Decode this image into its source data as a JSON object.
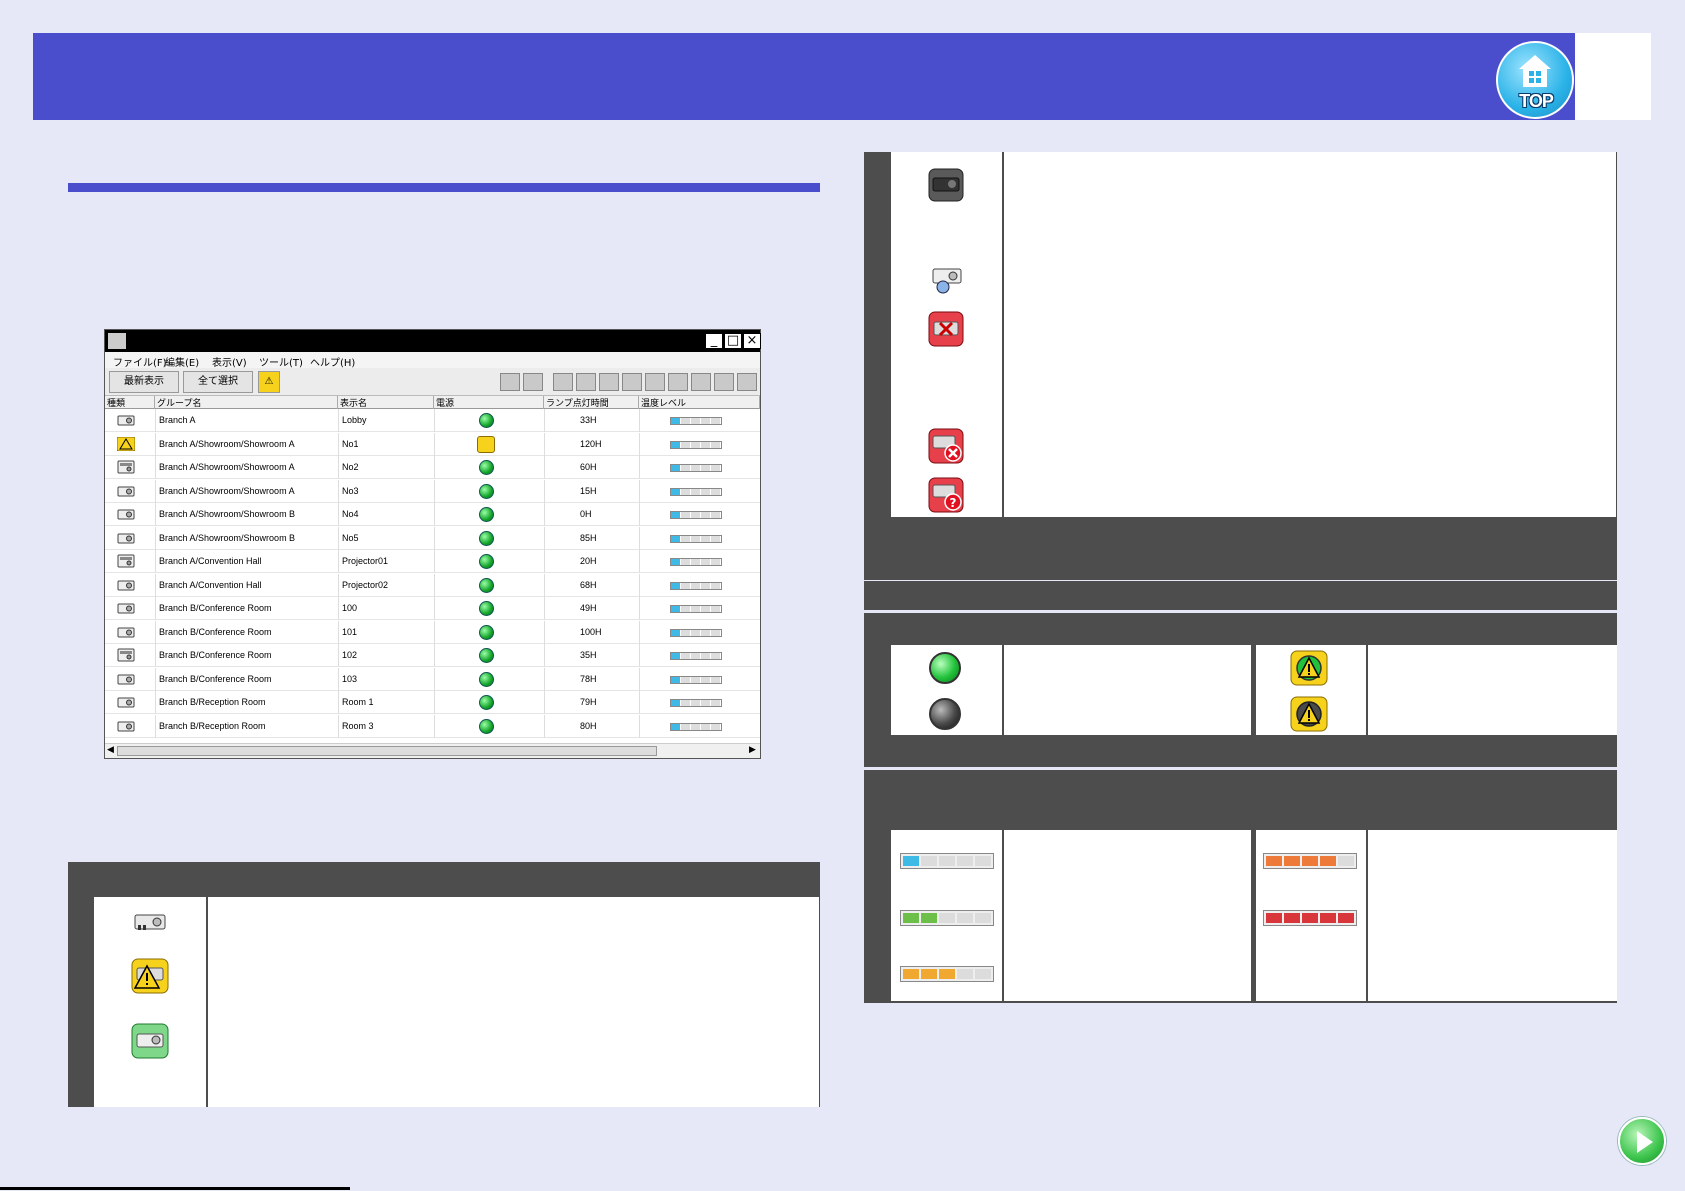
{
  "header": {
    "top_button_label": "TOP"
  },
  "window": {
    "menu": [
      "ファイル(F)",
      "編集(E)",
      "表示(V)",
      "ツール(T)",
      "ヘルプ(H)"
    ],
    "toolbar": {
      "refresh_label": "最新表示",
      "select_all_label": "全て選択"
    },
    "columns": [
      "種類",
      "グループ名",
      "表示名",
      "電源",
      "ランプ点灯時間",
      "温度レベル"
    ],
    "rows": [
      {
        "group": "Branch A",
        "name": "Lobby",
        "hours": "33H",
        "status": "normal"
      },
      {
        "group": "Branch A/Showroom/Showroom A",
        "name": "No1",
        "hours": "120H",
        "status": "warning"
      },
      {
        "group": "Branch A/Showroom/Showroom A",
        "name": "No2",
        "hours": "60H",
        "status": "multi"
      },
      {
        "group": "Branch A/Showroom/Showroom A",
        "name": "No3",
        "hours": "15H",
        "status": "normal"
      },
      {
        "group": "Branch A/Showroom/Showroom B",
        "name": "No4",
        "hours": "0H",
        "status": "normal"
      },
      {
        "group": "Branch A/Showroom/Showroom B",
        "name": "No5",
        "hours": "85H",
        "status": "normal"
      },
      {
        "group": "Branch A/Convention Hall",
        "name": "Projector01",
        "hours": "20H",
        "status": "multi"
      },
      {
        "group": "Branch A/Convention Hall",
        "name": "Projector02",
        "hours": "68H",
        "status": "normal"
      },
      {
        "group": "Branch B/Conference Room",
        "name": "100",
        "hours": "49H",
        "status": "normal"
      },
      {
        "group": "Branch B/Conference Room",
        "name": "101",
        "hours": "100H",
        "status": "normal"
      },
      {
        "group": "Branch B/Conference Room",
        "name": "102",
        "hours": "35H",
        "status": "multi"
      },
      {
        "group": "Branch B/Conference Room",
        "name": "103",
        "hours": "78H",
        "status": "normal"
      },
      {
        "group": "Branch B/Reception Room",
        "name": "Room 1",
        "hours": "79H",
        "status": "normal"
      },
      {
        "group": "Branch B/Reception Room",
        "name": "Room 3",
        "hours": "80H",
        "status": "normal"
      }
    ]
  },
  "colors": {
    "header": "#4b4ecc",
    "background": "#e6e8f7",
    "panel_dark": "#4d4d4d",
    "temp_blue": "#3fb9e6",
    "temp_green": "#6cc04a",
    "temp_orange": "#f0a830",
    "temp_deep_orange": "#ee7a3a",
    "temp_red": "#d9363c"
  },
  "icons": {
    "projector": "projector-icon",
    "projector_warning": "projector-warning-icon",
    "projector_selected": "projector-selected-icon",
    "projector_dark": "projector-standby-icon",
    "projector_network": "projector-network-icon",
    "projector_error": "projector-error-icon",
    "projector_comm_error": "projector-communication-error-icon",
    "projector_unknown": "projector-unknown-icon",
    "next": "next-page-icon"
  }
}
